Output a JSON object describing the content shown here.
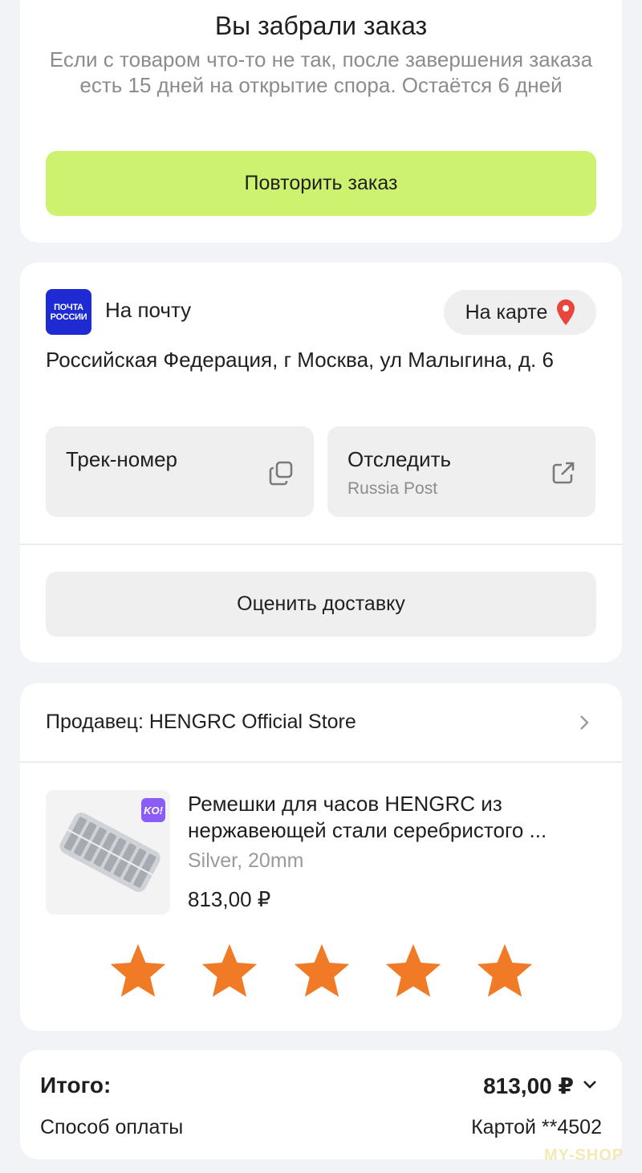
{
  "status": {
    "title": "Вы забрали заказ",
    "description": "Если с товаром что-то не так, после завершения заказа есть 15 дней на открытие спора. Остаётся 6 дней",
    "repeat_button": "Повторить заказ"
  },
  "delivery": {
    "logo_text_line1": "ПОЧТА",
    "logo_text_line2": "РОССИИ",
    "method": "На почту",
    "map_button": "На карте",
    "address": "Российская Федерация, г Москва, ул Малыгина, д. 6",
    "track_label": "Трек-номер",
    "follow_label": "Отследить",
    "follow_carrier": "Russia Post",
    "rate_button": "Оценить доставку"
  },
  "seller": {
    "label": "Продавец: HENGRC Official Store"
  },
  "product": {
    "name": "Ремешки для часов HENGRC из нержавеющей стали серебристого ...",
    "variant": "Silver, 20mm",
    "price": "813,00 ₽",
    "badge": "KO!",
    "rating": 5,
    "star_color": "#f07a26"
  },
  "summary": {
    "total_label": "Итого:",
    "total_value": "813,00 ₽",
    "payment_label": "Способ оплаты",
    "payment_value": "Картой **4502"
  },
  "watermark": "MY-SHOP",
  "colors": {
    "accent": "#cdf270",
    "post_blue": "#1f2bd2",
    "pin_red": "#e8453c"
  }
}
